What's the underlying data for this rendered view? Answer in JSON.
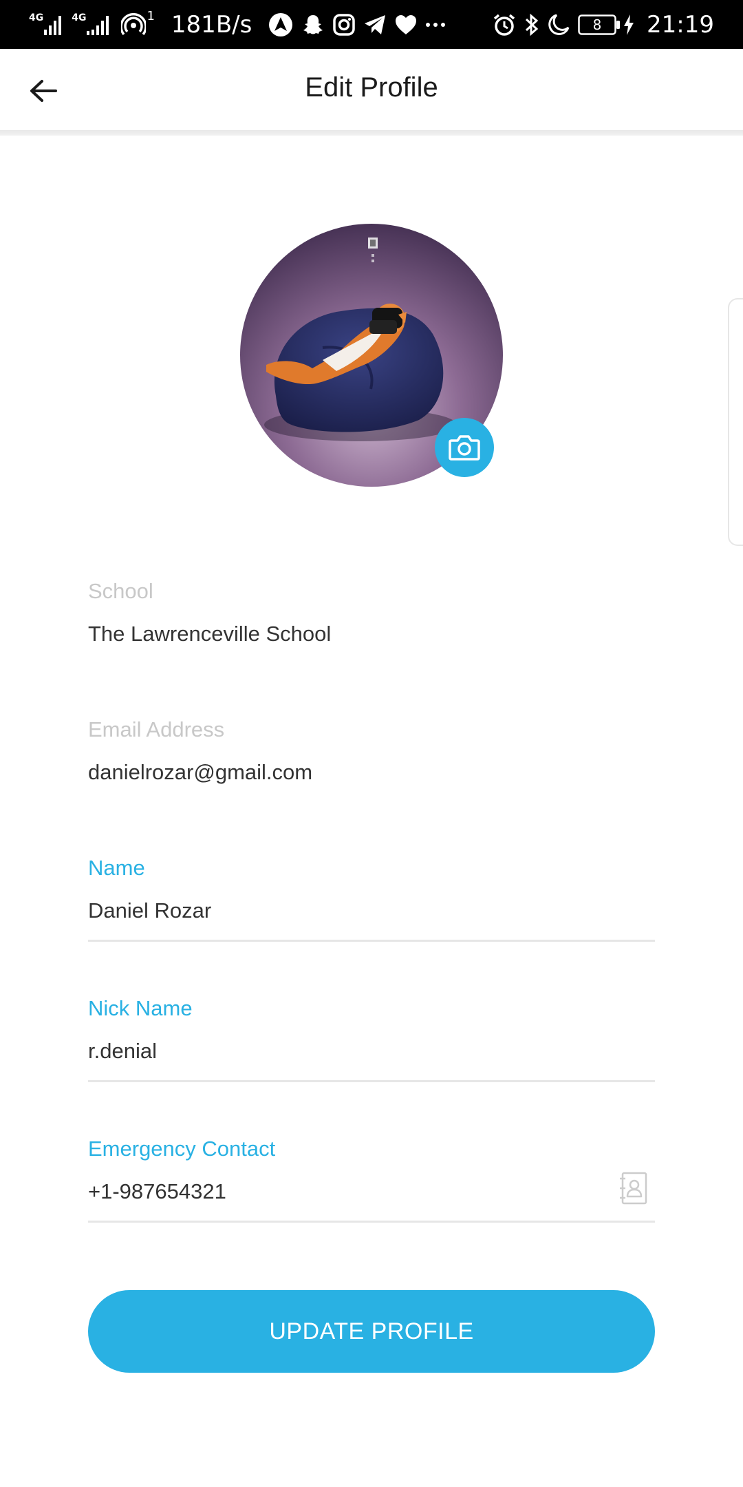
{
  "status_bar": {
    "network_1": "4G",
    "network_2": "4G",
    "hotspot_count": "1",
    "speed": "181B/s",
    "notification_icons": [
      "nav-app-icon",
      "snapchat-icon",
      "instagram-icon",
      "telegram-icon",
      "heart-icon",
      "more-icon"
    ],
    "system_icons": [
      "alarm-icon",
      "bluetooth-icon",
      "moon-icon",
      "battery-icon",
      "charging-icon"
    ],
    "battery_level": "8",
    "time": "21:19"
  },
  "header": {
    "title": "Edit Profile",
    "back_icon": "arrow-left-icon"
  },
  "profile": {
    "avatar_icon": "avatar-photo",
    "camera_icon": "camera-icon"
  },
  "fields": {
    "school": {
      "label": "School",
      "value": "The Lawrenceville School"
    },
    "email": {
      "label": "Email Address",
      "value": "danielrozar@gmail.com"
    },
    "name": {
      "label": "Name",
      "value": "Daniel Rozar"
    },
    "nickname": {
      "label": "Nick Name",
      "value": "r.denial"
    },
    "emergency": {
      "label": "Emergency Contact",
      "value": "+1-987654321",
      "icon": "contacts-book-icon"
    }
  },
  "actions": {
    "update_label": "UPDATE PROFILE"
  },
  "colors": {
    "accent": "#29b1e3",
    "muted_label": "#c8c8c8",
    "text": "#333333"
  }
}
